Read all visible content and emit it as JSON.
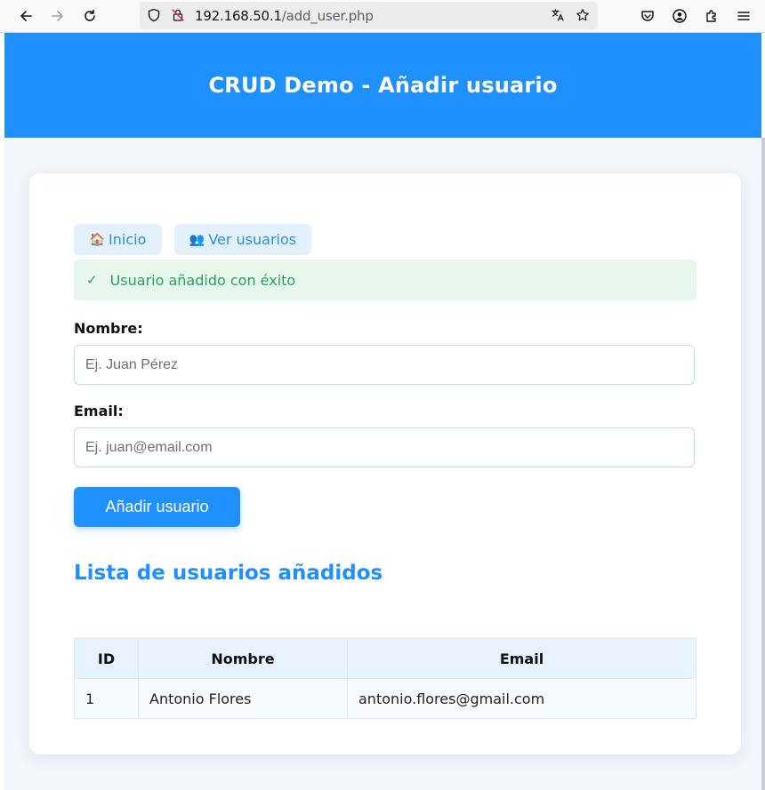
{
  "browser": {
    "url_host": "192.168.50.1",
    "url_path": "/add_user.php"
  },
  "header": {
    "title": "CRUD Demo - Añadir usuario"
  },
  "nav": {
    "home_icon": "🏠",
    "home_label": "Inicio",
    "users_icon": "👥",
    "users_label": "Ver usuarios"
  },
  "alert": {
    "icon": "✓",
    "message": "Usuario añadido con éxito"
  },
  "form": {
    "name_label": "Nombre:",
    "name_placeholder": "Ej. Juan Pérez",
    "name_value": "",
    "email_label": "Email:",
    "email_placeholder": "Ej. juan@email.com",
    "email_value": "",
    "submit_label": "Añadir usuario"
  },
  "list": {
    "title": "Lista de usuarios añadidos",
    "columns": [
      "ID",
      "Nombre",
      "Email"
    ],
    "rows": [
      {
        "id": "1",
        "nombre": "Antonio Flores",
        "email": "antonio.flores@gmail.com"
      }
    ]
  },
  "colors": {
    "primary": "#1e90ff",
    "success_text": "#2aa05a",
    "success_bg": "#e8f7ee",
    "nav_bg": "#e3f1fd"
  }
}
